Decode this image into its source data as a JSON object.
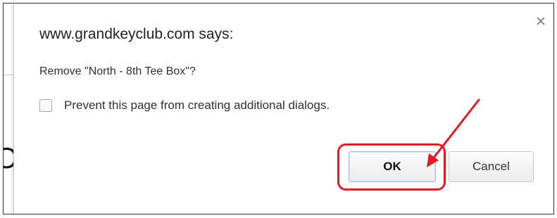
{
  "dialog": {
    "title": "www.grandkeyclub.com says:",
    "message": "Remove \"North - 8th Tee Box\"?",
    "prevent_label": "Prevent this page from creating additional dialogs.",
    "prevent_checked": false,
    "close_icon": "close-icon",
    "buttons": {
      "ok_label": "OK",
      "cancel_label": "Cancel"
    }
  },
  "annotation": {
    "color": "#e01b24",
    "type": "red arrow and rounded box pointing to OK button"
  }
}
